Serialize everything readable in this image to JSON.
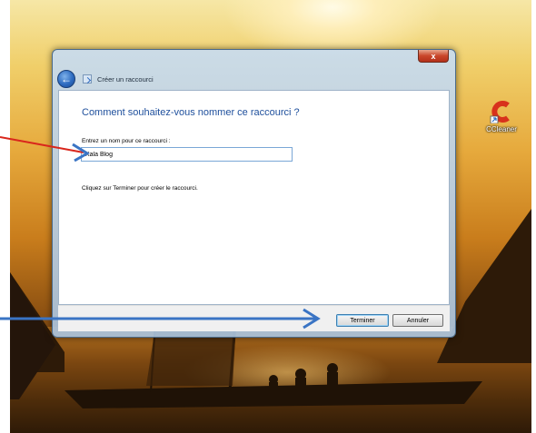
{
  "desktop": {
    "icon_label": "CCleaner",
    "icon_name": "ccleaner-shortcut-icon"
  },
  "window": {
    "title": "Créer un raccourci",
    "close_glyph": "x",
    "back_glyph": "←",
    "heading": "Comment souhaitez-vous nommer ce raccourci ?",
    "field_label": "Entrez un nom pour ce raccourci :",
    "field_value": "Kala Blog",
    "hint": "Cliquez sur Terminer pour créer le raccourci.",
    "buttons": {
      "finish": "Terminer",
      "cancel": "Annuler"
    }
  },
  "annotations": {
    "arrow_color": "#3a74c4",
    "field_arrow_color": "#d9261c"
  }
}
